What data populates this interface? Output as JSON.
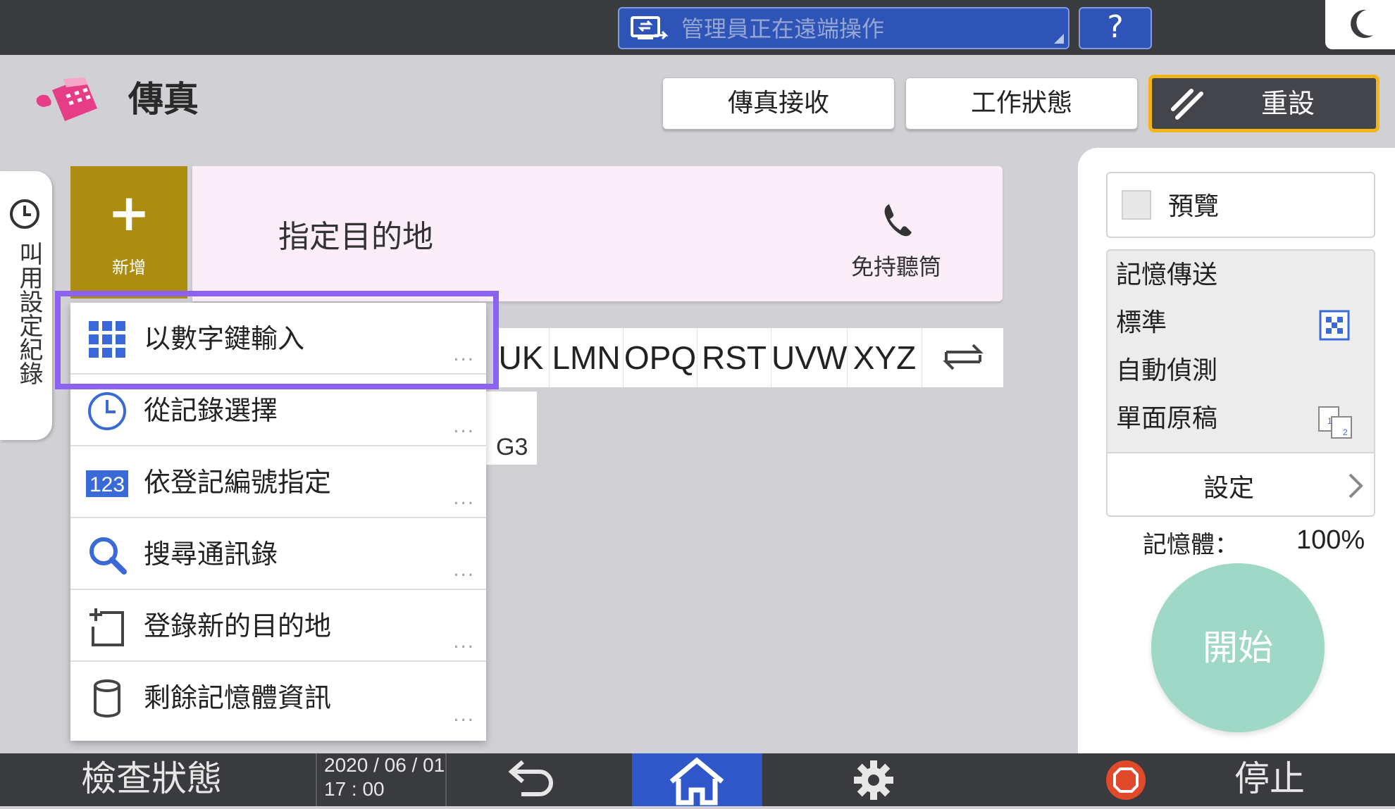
{
  "topbar": {
    "remote_status": "管理員正在遠端操作",
    "help_label": "?",
    "icons": [
      "remote-operation-icon",
      "moon-icon"
    ]
  },
  "header": {
    "app_title": "傳真",
    "fax_receive": "傳真接收",
    "job_status": "工作狀態",
    "reset": "重設"
  },
  "side_tab": {
    "label": "叫用設定紀錄"
  },
  "destination": {
    "add_label": "新增",
    "add_symbol": "+",
    "field_label": "指定目的地",
    "handsfree": "免持聽筒"
  },
  "alpha_tabs": [
    "UK",
    "LMN",
    "OPQ",
    "RST",
    "UVW",
    "XYZ"
  ],
  "line_type": "G3",
  "menu": {
    "items": [
      {
        "label": "以數字鍵輸入",
        "icon": "keypad-icon"
      },
      {
        "label": "從記錄選擇",
        "icon": "clock-icon"
      },
      {
        "label": "依登記編號指定",
        "icon": "number-123-icon"
      },
      {
        "label": "搜尋通訊錄",
        "icon": "search-icon"
      },
      {
        "label": "登錄新的目的地",
        "icon": "add-destination-icon"
      },
      {
        "label": "剩餘記憶體資訊",
        "icon": "memory-cylinder-icon"
      }
    ],
    "more": "...",
    "icon_label_123": "123"
  },
  "right_panel": {
    "preview": "預覽",
    "settings": [
      "記憶傳送",
      "標準",
      "自動偵測",
      "單面原稿"
    ],
    "settings_button": "設定",
    "memory_label": "記憶體：",
    "memory_value": "100%",
    "start": "開始"
  },
  "bottombar": {
    "check_status": "檢查狀態",
    "date": "2020 / 06 / 01",
    "time": "17 : 00",
    "stop": "停止"
  },
  "colors": {
    "accent_blue": "#2f54b8",
    "reset_border": "#f3b417",
    "add_button": "#ad8c12",
    "highlight": "#8b63f0",
    "start": "#9fd8c7",
    "icon_blue": "#3a6ad8"
  }
}
